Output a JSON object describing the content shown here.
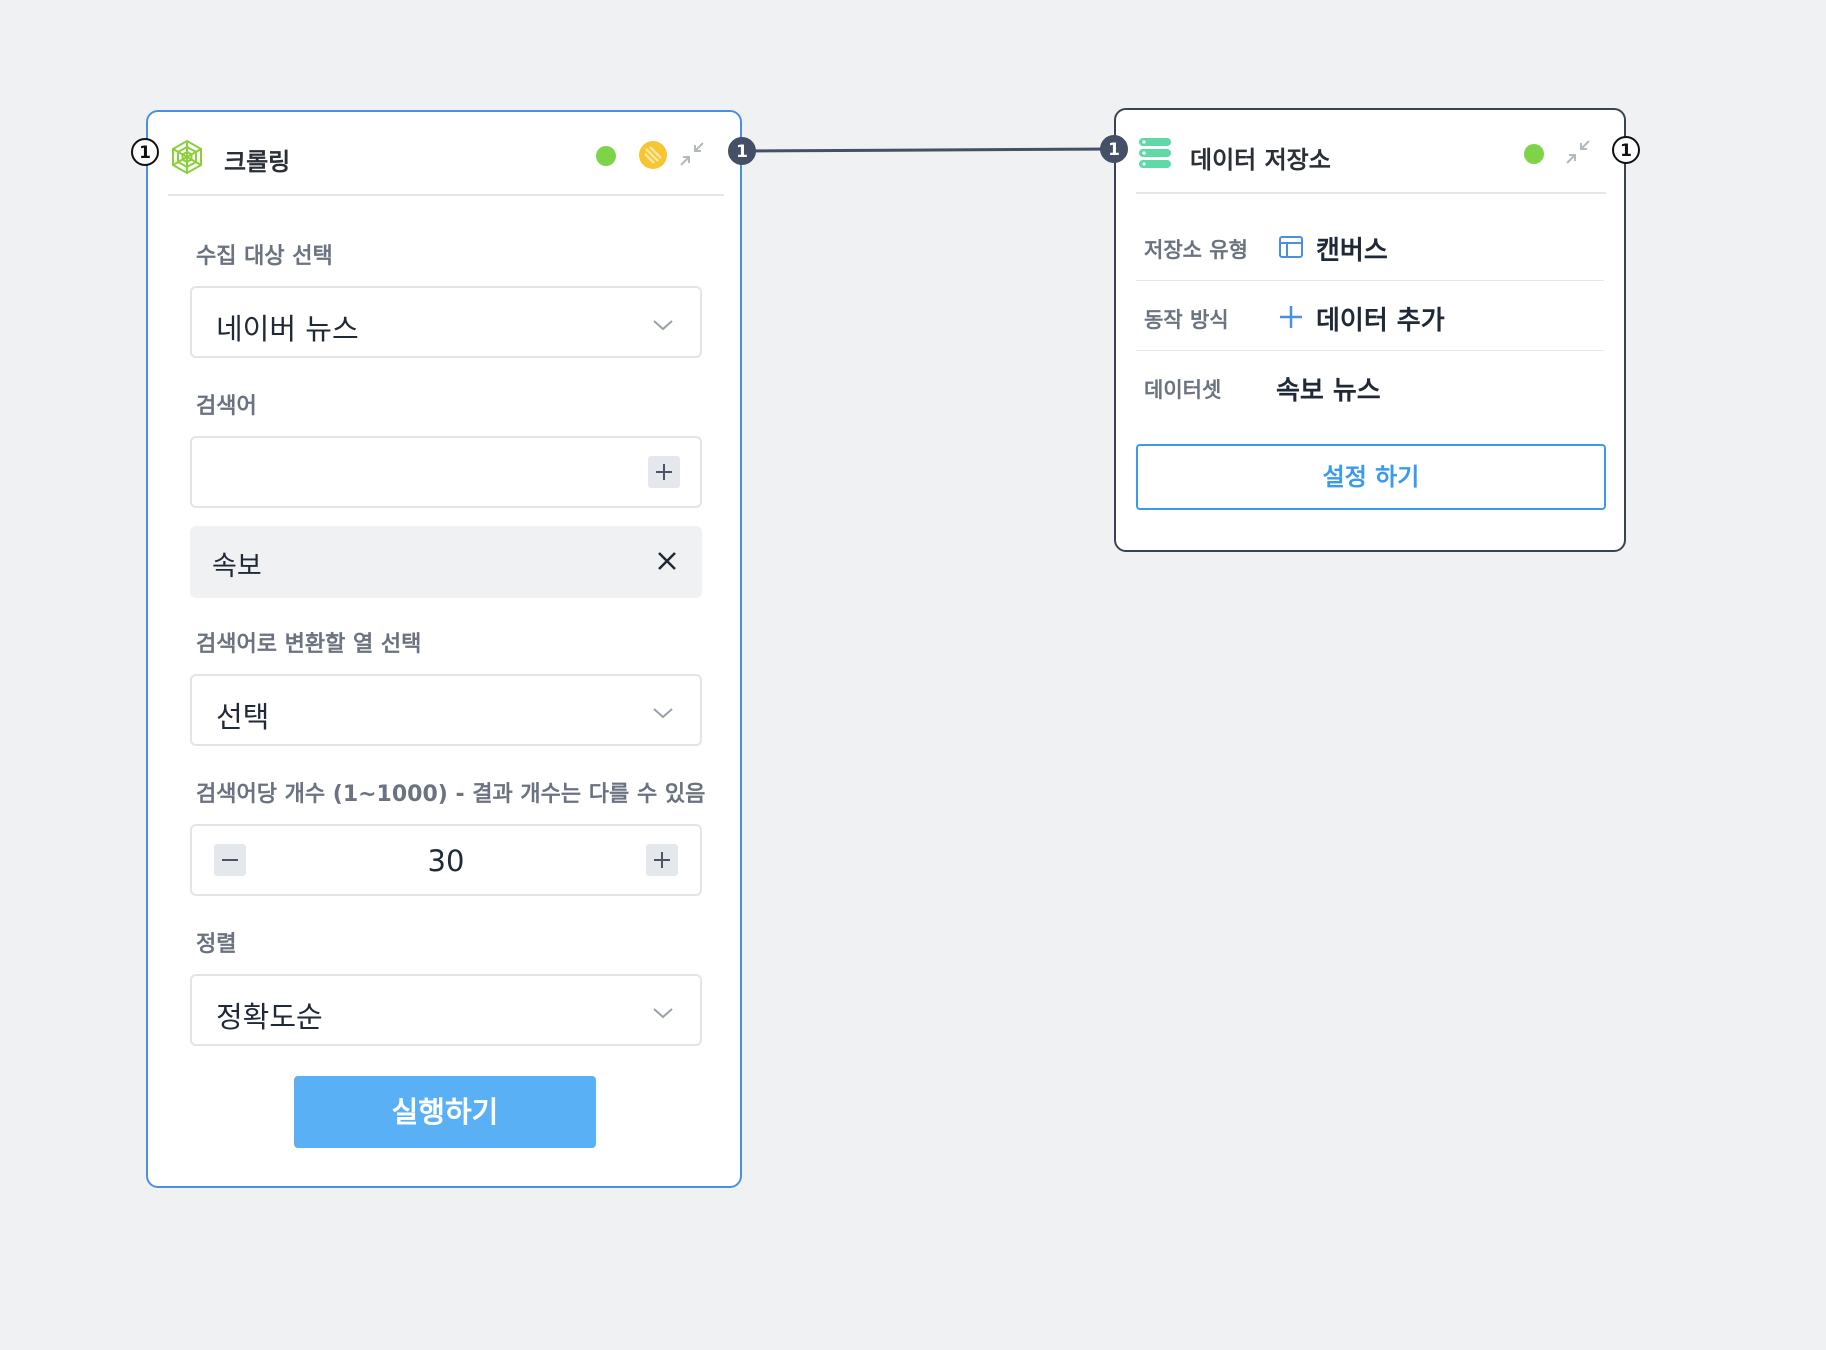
{
  "crawl_node": {
    "title": "크롤링",
    "input_port": "1",
    "output_port": "1",
    "status_color": "#7ed348",
    "icons": {
      "title": "spider-web-icon",
      "avatar": "avatar-icon",
      "collapse": "collapse-icon"
    },
    "target_field": {
      "label": "수집 대상 선택",
      "value": "네이버 뉴스"
    },
    "keyword_field": {
      "label": "검색어",
      "value": "",
      "tag": "속보"
    },
    "column_field": {
      "label": "검색어로 변환할 열 선택",
      "value": "선택"
    },
    "count_field": {
      "label": "검색어당 개수 (1~1000) - 결과 개수는 다를 수 있음",
      "value": "30"
    },
    "sort_field": {
      "label": "정렬",
      "value": "정확도순"
    },
    "run_button": "실행하기"
  },
  "storage_node": {
    "title": "데이터 저장소",
    "input_port": "1",
    "output_port": "1",
    "status_color": "#7ed348",
    "icons": {
      "title": "database-icon",
      "collapse": "collapse-icon"
    },
    "rows": [
      {
        "label": "저장소 유형",
        "value": "캔버스",
        "icon": "table-icon"
      },
      {
        "label": "동작 방식",
        "value": "데이터 추가",
        "icon": "plus-icon"
      },
      {
        "label": "데이터셋",
        "value": "속보 뉴스"
      }
    ],
    "settings_button": "설정 하기"
  },
  "colors": {
    "accent": "#4a90e2",
    "run_button": "#5ab0f5",
    "connector": "#445066"
  }
}
